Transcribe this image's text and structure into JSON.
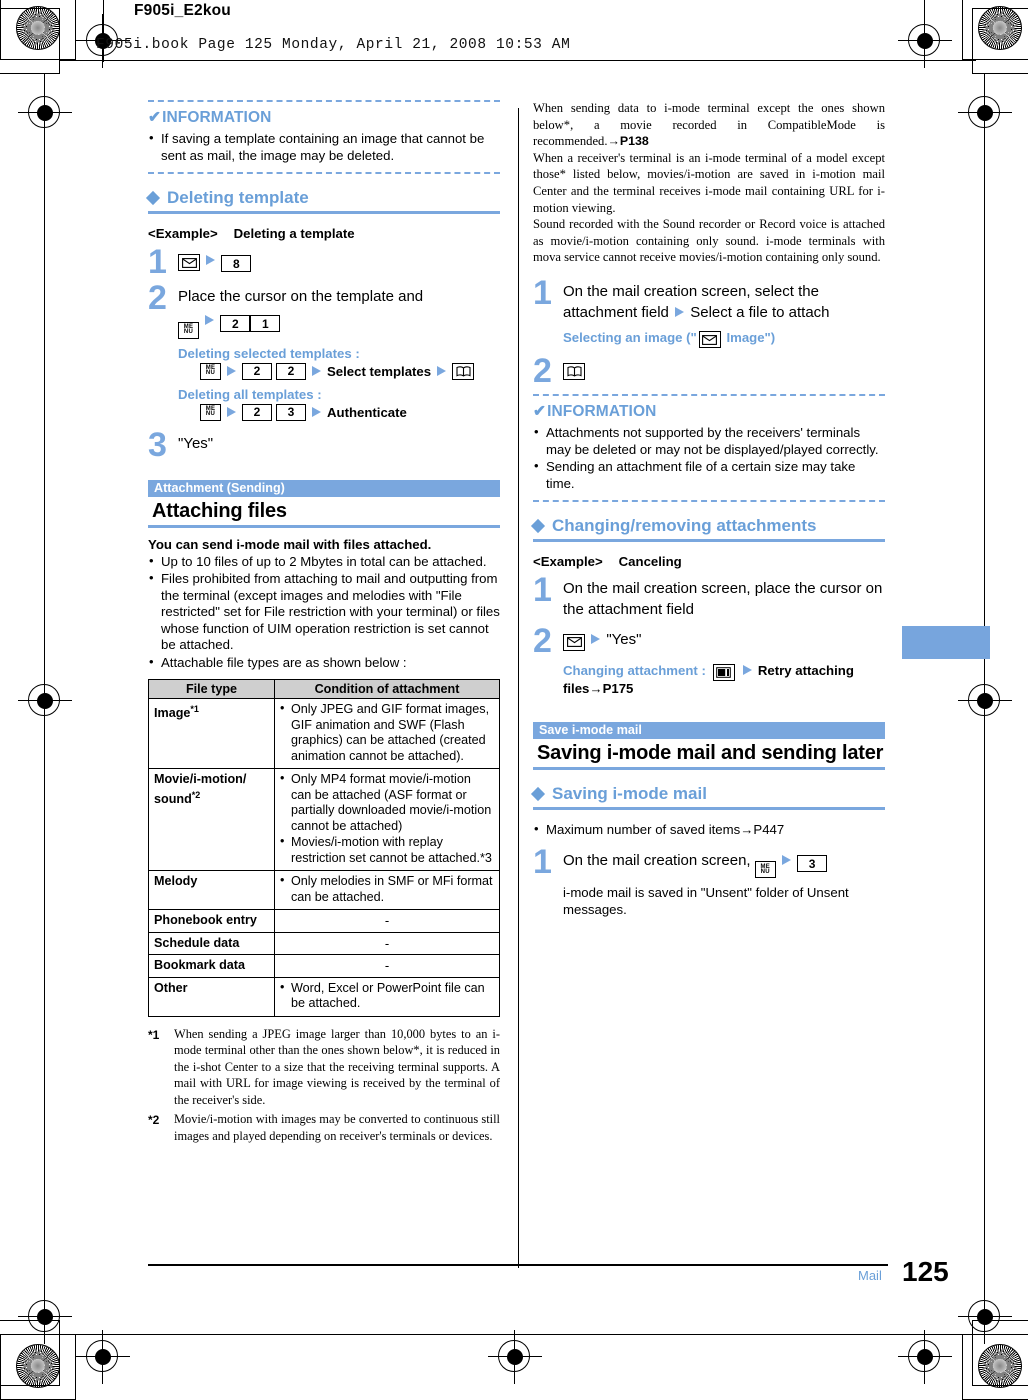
{
  "header": {
    "doc_code": "F905i_E2kou",
    "book_line": "F905i.book  Page 125  Monday, April 21, 2008  10:53 AM"
  },
  "footer": {
    "section_tag": "Mail",
    "page_number": "125"
  },
  "left_column": {
    "information_1": {
      "title": "INFORMATION",
      "check_mark": "✔",
      "items": [
        "If saving a template containing an image that cannot be sent as mail, the image may be deleted."
      ]
    },
    "deleting_template": {
      "heading": "Deleting template",
      "example_label": "<Example>",
      "example_text": "Deleting a template",
      "steps": [
        {
          "number": "1",
          "keys": [
            "mail-icon",
            "arrow",
            "key-8"
          ]
        },
        {
          "number": "2",
          "text": "Place the cursor on the template and",
          "keys": [
            "menu-icon",
            "arrow",
            "key-2",
            "key-1"
          ]
        },
        {
          "number": "3",
          "text": "\"Yes\""
        }
      ],
      "sub_options": [
        {
          "label": "Deleting selected templates :",
          "sequence": [
            "menu-icon",
            "arrow",
            "key-2",
            "key-2",
            "arrow",
            "Select templates",
            "arrow",
            "book-icon"
          ]
        },
        {
          "label": "Deleting all templates :",
          "sequence": [
            "menu-icon",
            "arrow",
            "key-2",
            "key-3",
            "arrow",
            "Authenticate"
          ]
        }
      ]
    },
    "attachment_section": {
      "band": "Attachment (Sending)",
      "title": "Attaching files",
      "lead": "You can send i-mode mail with files attached.",
      "bullets": [
        "Up to 10 files of up to 2 Mbytes in total can be attached.",
        "Files prohibited from attaching to mail and outputting from the terminal (except images and melodies with \"File restricted\" set for File restriction with your terminal) or files whose function of UIM operation restriction is set cannot be attached.",
        "Attachable file types are as shown below :"
      ],
      "table": {
        "headers": [
          "File type",
          "Condition of attachment"
        ],
        "rows": [
          {
            "type": "Image",
            "type_sup": "*1",
            "conditions": [
              "Only JPEG and GIF format images, GIF animation and SWF (Flash graphics) can be attached (created animation cannot be attached)."
            ],
            "dash": false
          },
          {
            "type": "Movie/i-motion/ sound",
            "type_sup": "*2",
            "conditions": [
              "Only MP4 format movie/i-motion can be attached (ASF format or partially downloaded movie/i-motion cannot be attached)",
              "Movies/i-motion with replay restriction set cannot be attached.*3"
            ],
            "dash": false
          },
          {
            "type": "Melody",
            "type_sup": "",
            "conditions": [
              "Only melodies in SMF or MFi format can be attached."
            ],
            "dash": false
          },
          {
            "type": "Phonebook entry",
            "type_sup": "",
            "conditions": [],
            "dash": true,
            "dash_text": "-"
          },
          {
            "type": "Schedule data",
            "type_sup": "",
            "conditions": [],
            "dash": true,
            "dash_text": "-"
          },
          {
            "type": "Bookmark data",
            "type_sup": "",
            "conditions": [],
            "dash": true,
            "dash_text": "-"
          },
          {
            "type": "Other",
            "type_sup": "",
            "conditions": [
              "Word, Excel or PowerPoint file can be attached."
            ],
            "dash": false
          }
        ]
      },
      "footnotes": [
        {
          "marker": "*1",
          "text": "When sending a JPEG image larger than 10,000 bytes to an i-mode terminal other than the ones shown below*, it is reduced in the i-shot Center to a size that the receiving terminal supports. A mail with URL for image viewing is received by the terminal of the receiver's side."
        },
        {
          "marker": "*2",
          "text": "Movie/i-motion with images may be converted to continuous still images and played depending on receiver's terminals or devices."
        }
      ]
    }
  },
  "right_column": {
    "continued_note": {
      "paragraphs": [
        "When sending data to i-mode terminal except the ones shown below*, a movie recorded in CompatibleMode is recommended.",
        "When a receiver's terminal is an i-mode terminal of a model except those* listed below, movies/i-motion are saved in i-motion mail Center and the terminal receives i-mode mail containing URL for i-motion viewing.",
        "Sound recorded with the Sound recorder or Record voice is attached as movie/i-motion containing only sound. i-mode terminals with mova service cannot receive movies/i-motion containing only sound."
      ],
      "page_ref": "→P138"
    },
    "attach_steps": [
      {
        "number": "1",
        "text_a": "On the mail creation screen, select the attachment field",
        "arrow": "arrow",
        "text_b": "Select a file to attach",
        "sub_label": "Selecting an image (\"",
        "sub_icon": "mail-icon",
        "sub_label_end": " Image\")"
      },
      {
        "number": "2",
        "keys": [
          "book-icon"
        ]
      }
    ],
    "information_2": {
      "title": "INFORMATION",
      "check_mark": "✔",
      "items": [
        "Attachments not supported by the receivers' terminals may be deleted or may not be displayed/played correctly.",
        "Sending an attachment file of a certain size may take time."
      ]
    },
    "changing_removing": {
      "heading": "Changing/removing attachments",
      "example_label": "<Example>",
      "example_text": "Canceling",
      "steps": [
        {
          "number": "1",
          "text": "On the mail creation screen, place the cursor on the attachment field"
        },
        {
          "number": "2",
          "keys": [
            "mail-icon",
            "arrow"
          ],
          "text": "\"Yes\""
        }
      ],
      "sub_option": {
        "label": "Changing attachment :",
        "icon": "picture-icon",
        "arrow": "arrow",
        "text": "Retry attaching files",
        "page_ref": "→P175"
      }
    },
    "save_section": {
      "band": "Save i-mode mail",
      "title": "Saving i-mode mail and sending later",
      "heading": "Saving i-mode mail",
      "bullets": [
        "Maximum number of saved items→P447"
      ],
      "step": {
        "number": "1",
        "text": "On the mail creation screen,",
        "keys": [
          "menu-icon",
          "arrow",
          "key-3"
        ],
        "note": "i-mode mail is saved in \"Unsent\" folder of Unsent messages."
      }
    }
  },
  "icons": {
    "mail": "mail-icon",
    "menu": "menu-icon",
    "book": "book-icon",
    "picture": "picture-icon",
    "arrow": "arrow-right-icon"
  },
  "colors": {
    "accent_blue": "#7aa7de",
    "heading_blue": "#6a9fd8",
    "band_blue": "#7aa7de",
    "table_header_gray": "#cfcfcf"
  },
  "keys": {
    "k1": "1",
    "k2": "2",
    "k3": "3",
    "k8": "8"
  }
}
